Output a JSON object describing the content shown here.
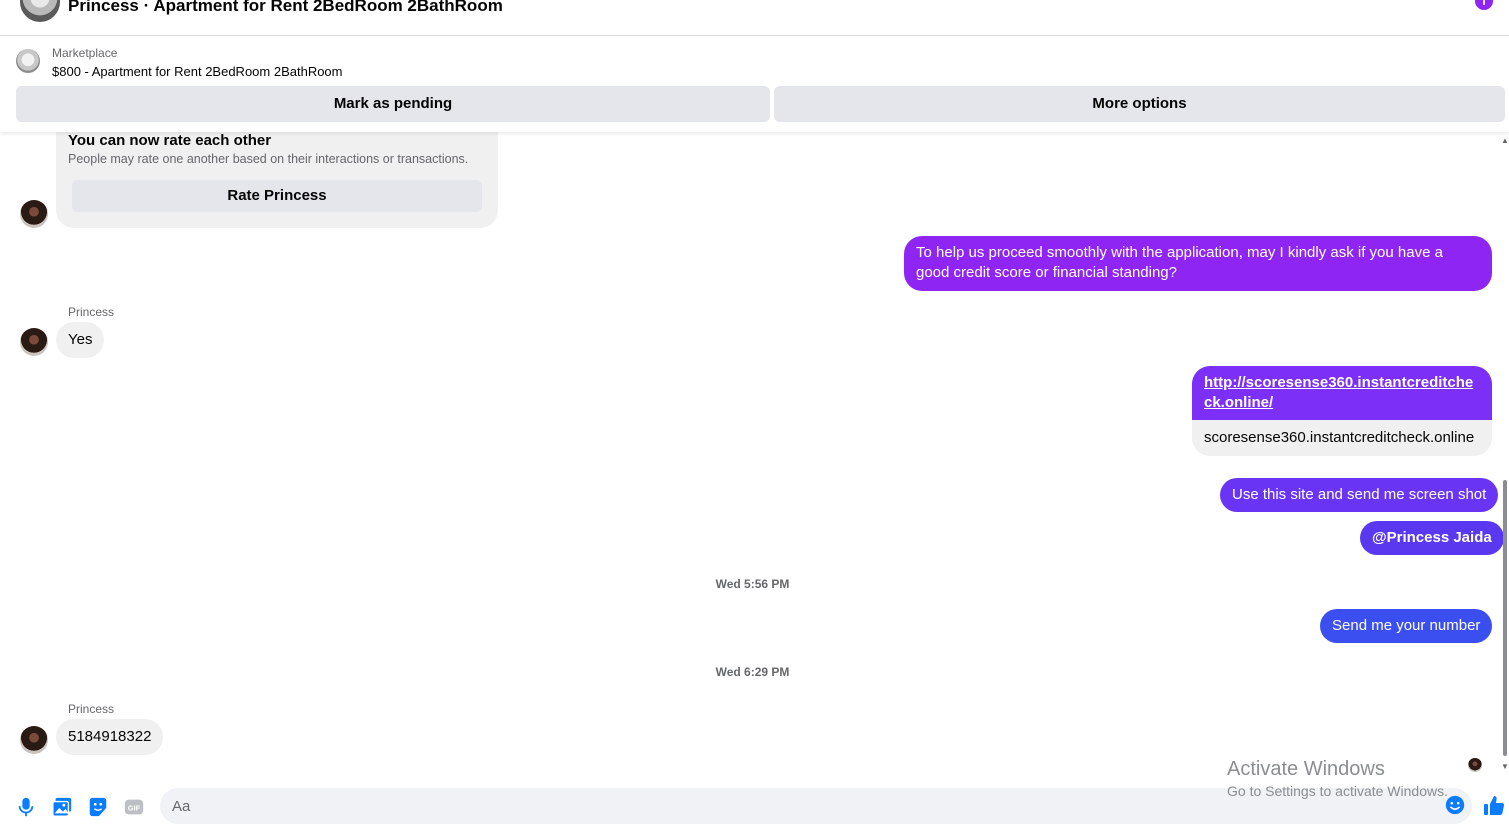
{
  "header": {
    "title": "Princess · Apartment for Rent 2BedRoom 2BathRoom",
    "info_icon": "info-icon"
  },
  "listing": {
    "category": "Marketplace",
    "title": "$800 - Apartment for Rent 2BedRoom 2BathRoom",
    "mark_pending_label": "Mark as pending",
    "more_options_label": "More options"
  },
  "rate_card": {
    "title": "You can now rate each other",
    "subtitle": "People may rate one another based on their interactions or transactions.",
    "button_label": "Rate Princess"
  },
  "messages": {
    "out_1": "To help us proceed smoothly with the application, may I kindly ask if you have a good credit score or financial standing?",
    "in_1_sender": "Princess",
    "in_1": "Yes",
    "link_url": "http://scoresense360.instantcreditcheck.online/",
    "link_domain": "scoresense360.instantcreditcheck.online",
    "out_2": "Use this site and send me screen shot",
    "out_3": "@Princess Jaida",
    "time_1": "Wed 5:56 PM",
    "out_4": "Send me your number",
    "time_2": "Wed 6:29 PM",
    "in_2_sender": "Princess",
    "in_2": "5184918322"
  },
  "composer": {
    "placeholder": "Aa"
  },
  "watermark": {
    "line1": "Activate Windows",
    "line2": "Go to Settings to activate Windows."
  },
  "colors": {
    "accent_purple": "#8f25f3",
    "bubble_violet": "#7b2ff7",
    "bubble_indigo": "#5a38f0",
    "bubble_blue": "#3b4ff0",
    "incoming_gray": "#f0f0f0",
    "icon_blue": "#0a7cff"
  }
}
